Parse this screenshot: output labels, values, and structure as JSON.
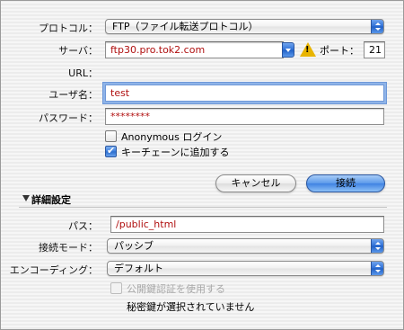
{
  "form": {
    "protocol_label": "プロトコル：",
    "protocol_value": "FTP（ファイル転送プロトコル）",
    "server_label": "サーバ：",
    "server_value": "ftp30.pro.tok2.com",
    "port_label": "ポート：",
    "port_value": "21",
    "url_label": "URL：",
    "user_label": "ユーザ名：",
    "user_value": "test",
    "password_label": "パスワード：",
    "password_value": "********",
    "anonymous_label": "Anonymous ログイン",
    "anonymous_checked": false,
    "keychain_label": "キーチェーンに追加する",
    "keychain_checked": true
  },
  "buttons": {
    "cancel": "キャンセル",
    "connect": "接続"
  },
  "advanced": {
    "title": "詳細設定",
    "path_label": "パス：",
    "path_value": "/public_html",
    "mode_label": "接続モード：",
    "mode_value": "パッシブ",
    "encoding_label": "エンコーディング：",
    "encoding_value": "デフォルト",
    "pubkey_label": "公開鍵認証を使用する",
    "pubkey_checked": false,
    "privkey_status": "秘密鍵が選択されていません"
  },
  "icons": {
    "warning": "warning-icon",
    "disclosure": "disclosure-triangle-icon"
  },
  "colors": {
    "value_text": "#b01010",
    "accent_blue": "#3f82e2",
    "warning": "#e8b400"
  }
}
